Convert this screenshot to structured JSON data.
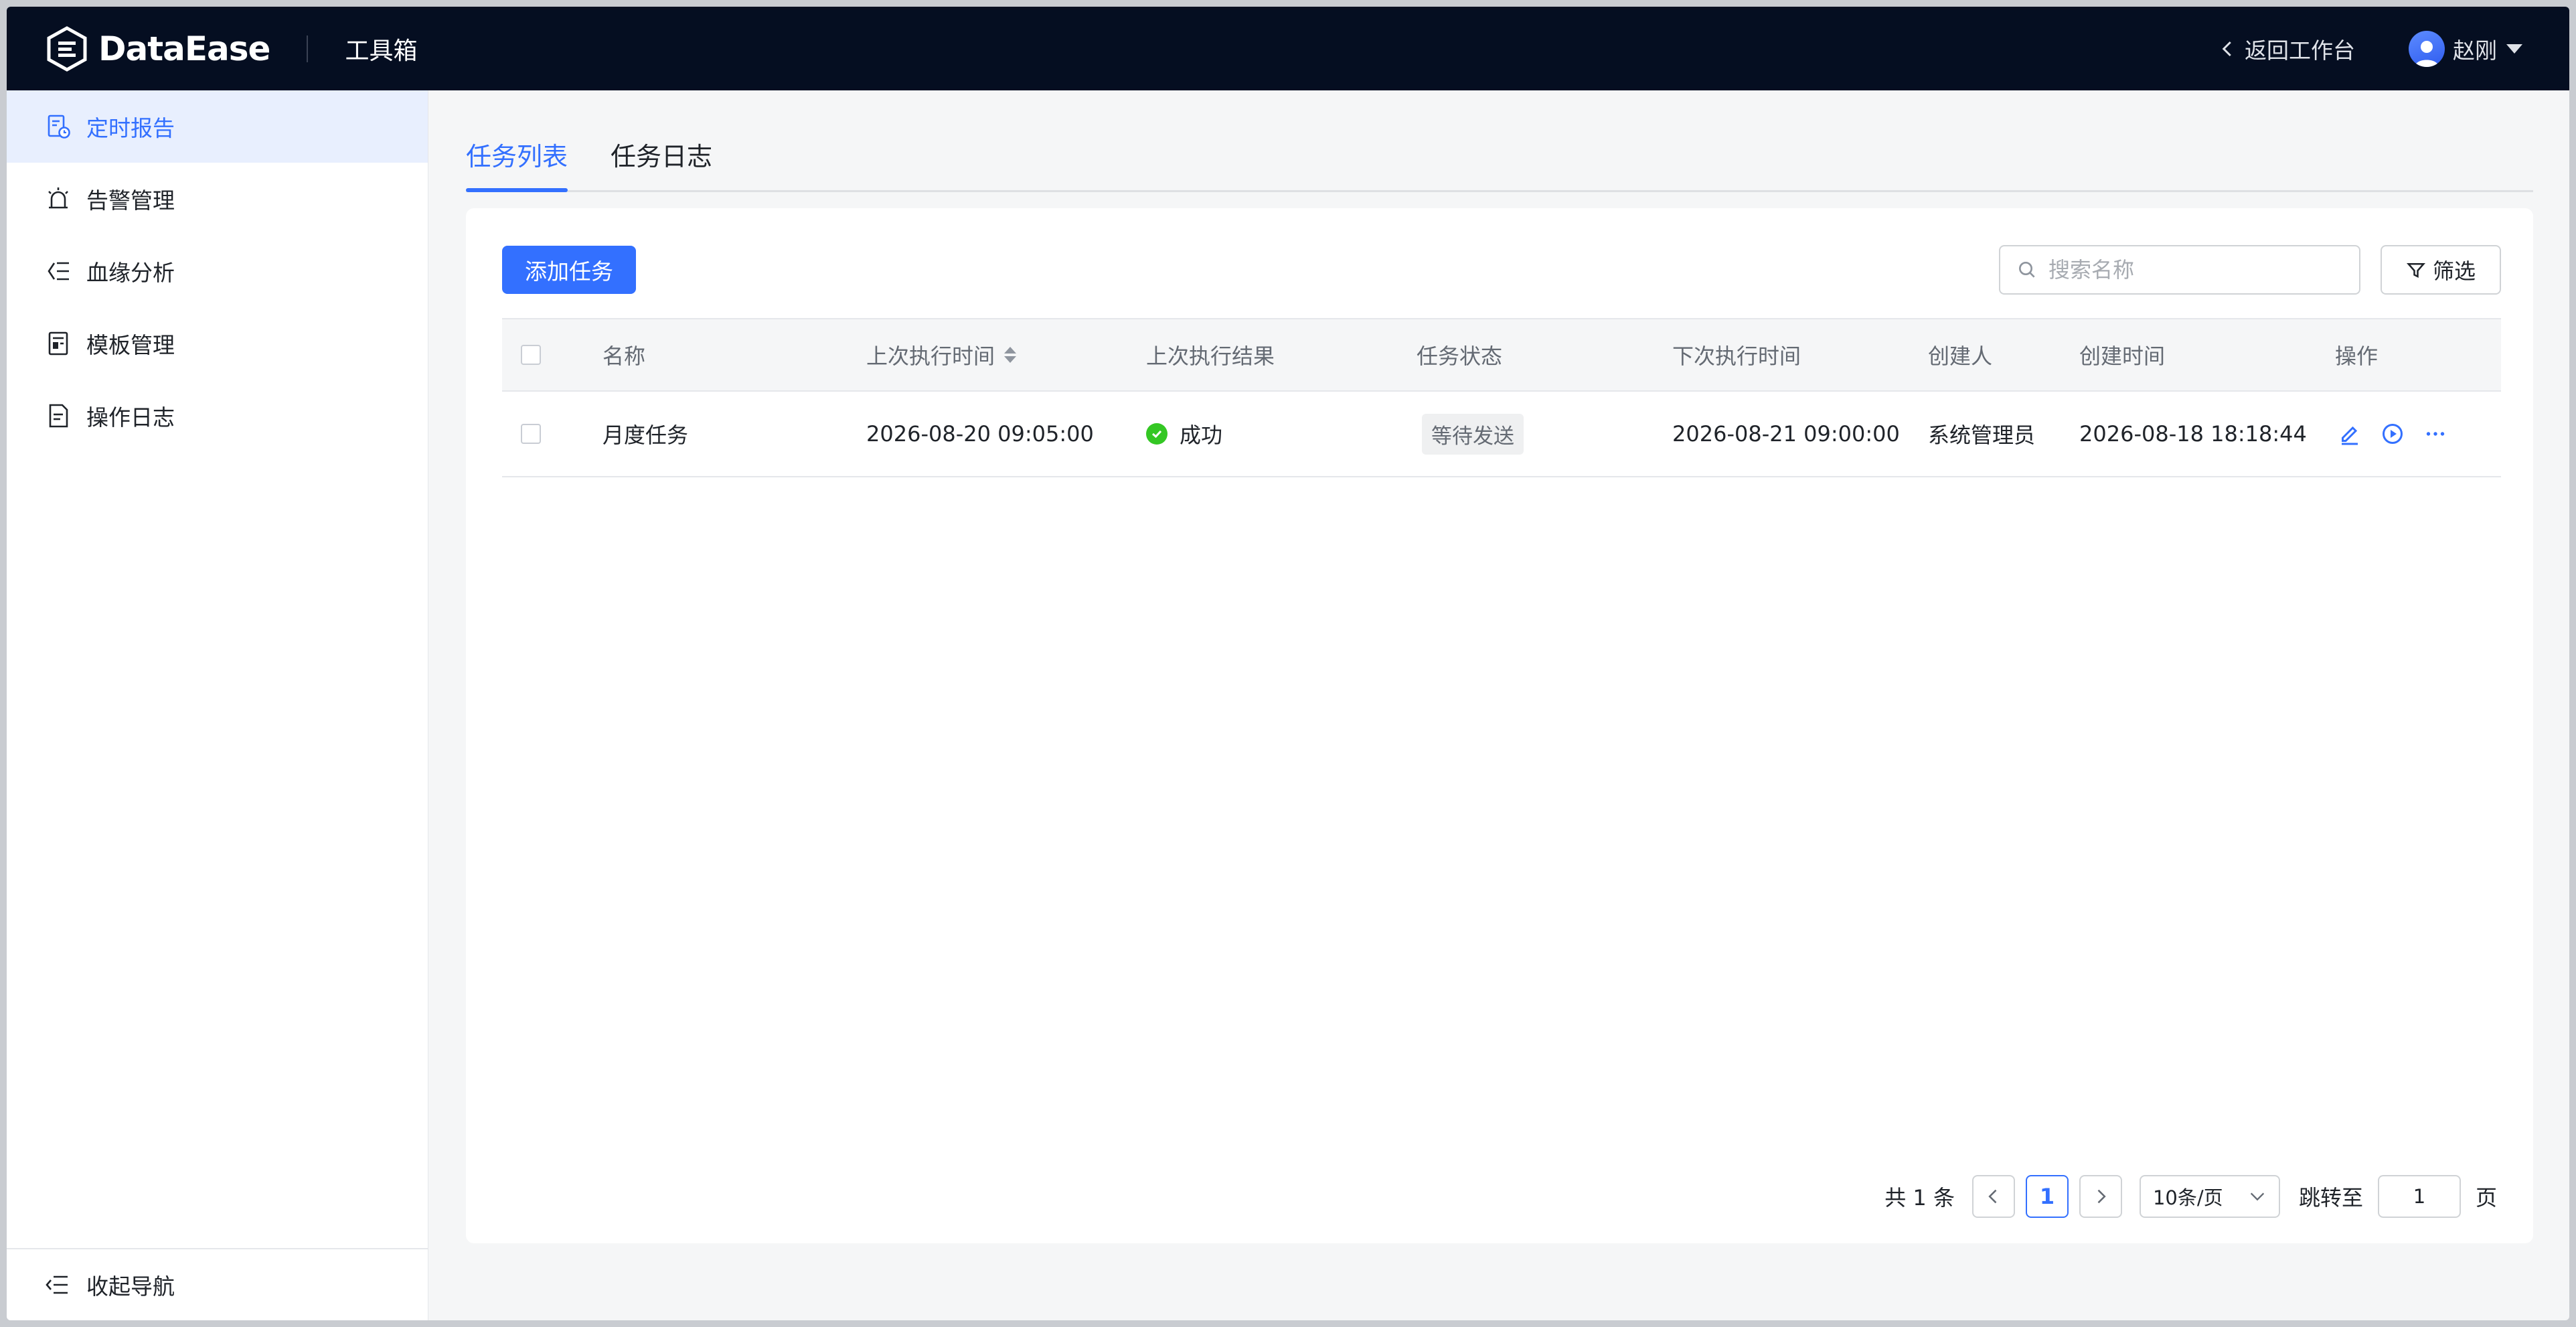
{
  "header": {
    "brand": "DataEase",
    "section": "工具箱",
    "back_label": "返回工作台",
    "user_name": "赵刚"
  },
  "sidebar": {
    "items": [
      {
        "label": "定时报告",
        "icon": "scheduled-report-icon",
        "active": true
      },
      {
        "label": "告警管理",
        "icon": "alarm-icon",
        "active": false
      },
      {
        "label": "血缘分析",
        "icon": "lineage-icon",
        "active": false
      },
      {
        "label": "模板管理",
        "icon": "template-icon",
        "active": false
      },
      {
        "label": "操作日志",
        "icon": "log-icon",
        "active": false
      }
    ],
    "collapse_label": "收起导航"
  },
  "tabs": [
    {
      "label": "任务列表",
      "active": true
    },
    {
      "label": "任务日志",
      "active": false
    }
  ],
  "toolbar": {
    "add_label": "添加任务",
    "search_placeholder": "搜索名称",
    "filter_label": "筛选"
  },
  "table": {
    "columns": [
      "名称",
      "上次执行时间",
      "上次执行结果",
      "任务状态",
      "下次执行时间",
      "创建人",
      "创建时间",
      "操作"
    ],
    "rows": [
      {
        "name": "月度任务",
        "last_run": "2026-08-20 09:05:00",
        "last_result": "成功",
        "status": "等待发送",
        "next_run": "2026-08-21 09:00:00",
        "creator": "系统管理员",
        "created_at": "2026-08-18 18:18:44"
      }
    ]
  },
  "pagination": {
    "total_label": "共 1 条",
    "current_page": "1",
    "page_size": "10条/页",
    "jump_label": "跳转至",
    "jump_value": "1",
    "page_suffix": "页"
  },
  "colors": {
    "accent": "#3370ff",
    "header_bg": "#050e21",
    "success": "#34c724"
  }
}
